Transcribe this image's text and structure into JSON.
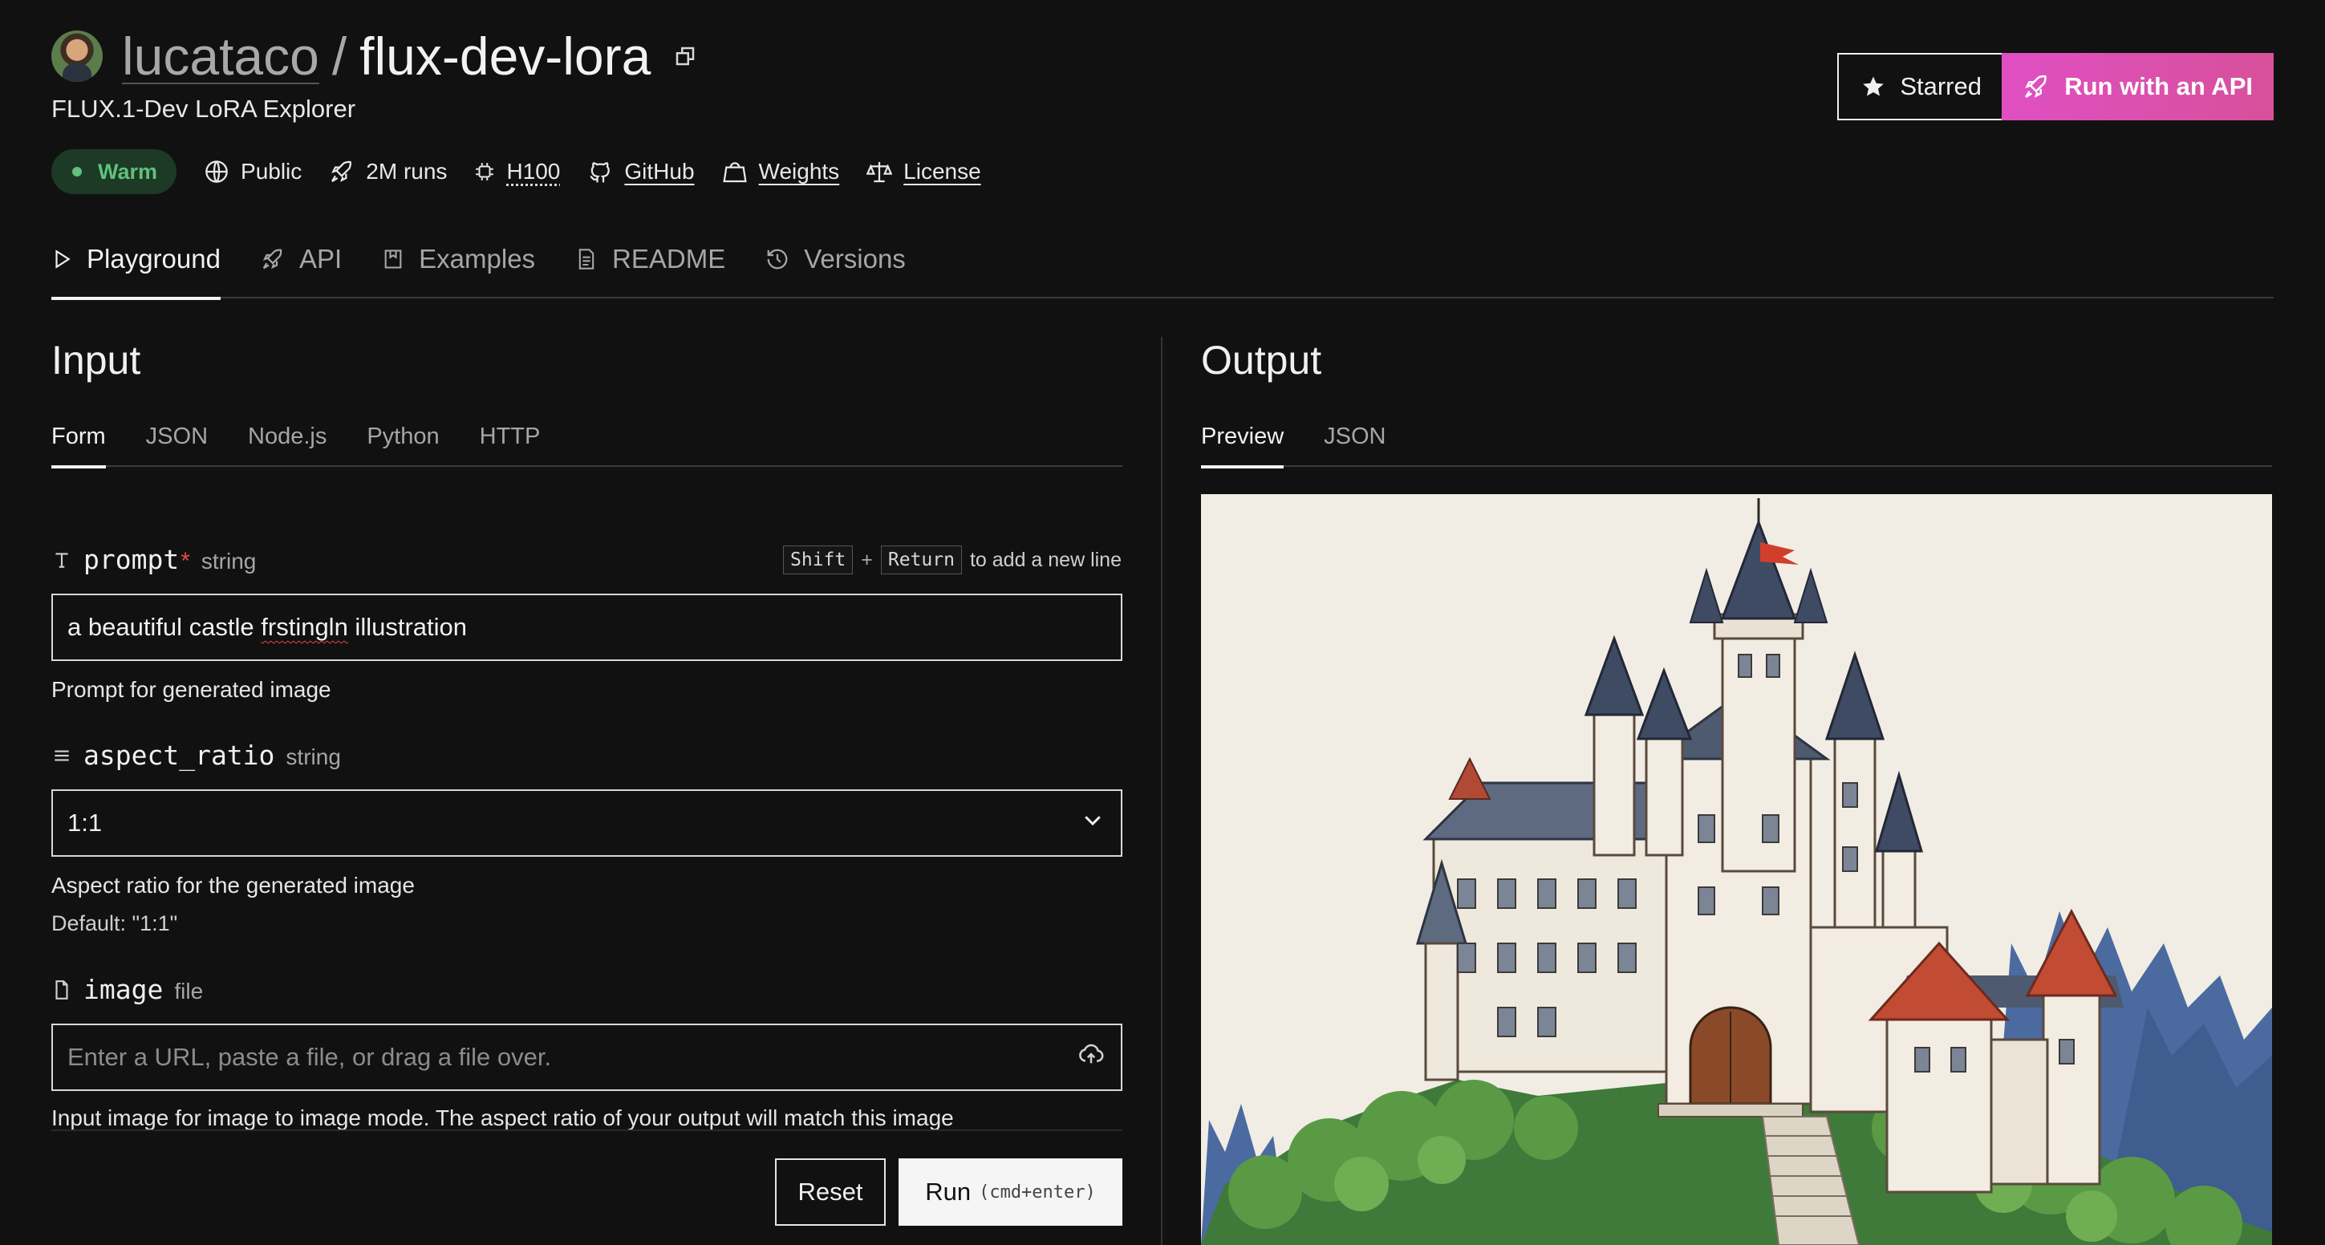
{
  "header": {
    "owner": "lucataco",
    "separator": "/",
    "model": "flux-dev-lora",
    "subtitle": "FLUX.1-Dev LoRA Explorer",
    "status": "Warm",
    "meta": {
      "visibility": "Public",
      "runs": "2M runs",
      "hardware": "H100",
      "github": "GitHub",
      "weights": "Weights",
      "license": "License"
    },
    "starred_label": "Starred",
    "api_label": "Run with an API"
  },
  "tabs": [
    {
      "label": "Playground",
      "active": true
    },
    {
      "label": "API"
    },
    {
      "label": "Examples"
    },
    {
      "label": "README"
    },
    {
      "label": "Versions"
    }
  ],
  "input": {
    "title": "Input",
    "subtabs": [
      "Form",
      "JSON",
      "Node.js",
      "Python",
      "HTTP"
    ],
    "prompt": {
      "name": "prompt",
      "required": "*",
      "type": "string",
      "hint_key1": "Shift",
      "hint_plus": "+",
      "hint_key2": "Return",
      "hint_text": "to add a new line",
      "value_before": "a beautiful castle ",
      "value_flagged": "frstingln",
      "value_after": " illustration",
      "help": "Prompt for generated image"
    },
    "aspect_ratio": {
      "name": "aspect_ratio",
      "type": "string",
      "value": "1:1",
      "help": "Aspect ratio for the generated image",
      "default": "Default: \"1:1\""
    },
    "image": {
      "name": "image",
      "type": "file",
      "placeholder": "Enter a URL, paste a file, or drag a file over.",
      "help": "Input image for image to image mode. The aspect ratio of your output will match this image"
    },
    "reset_label": "Reset",
    "run_label": "Run",
    "run_shortcut": "(cmd+enter)"
  },
  "output": {
    "title": "Output",
    "subtabs": [
      "Preview",
      "JSON"
    ]
  },
  "colors": {
    "background": "#111111",
    "accent_pink": "#e04fc3",
    "warm_green": "#61c07b",
    "required_red": "#e5484d"
  }
}
